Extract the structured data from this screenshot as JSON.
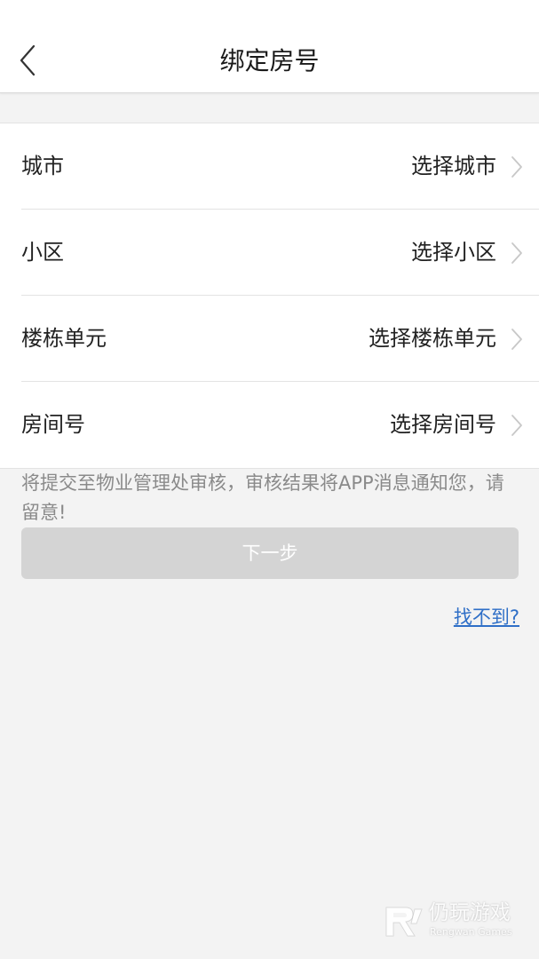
{
  "header": {
    "title": "绑定房号",
    "back_icon": "chevron-left-icon"
  },
  "form": {
    "rows": [
      {
        "label": "城市",
        "value": "选择城市",
        "icon": "chevron-right-icon"
      },
      {
        "label": "小区",
        "value": "选择小区",
        "icon": "chevron-right-icon"
      },
      {
        "label": "楼栋单元",
        "value": "选择楼栋单元",
        "icon": "chevron-right-icon"
      },
      {
        "label": "房间号",
        "value": "选择房间号",
        "icon": "chevron-right-icon"
      }
    ]
  },
  "notice": "将提交至物业管理处审核，审核结果将APP消息通知您，请留意!",
  "actions": {
    "next_label": "下一步",
    "not_found_label": "找不到?"
  },
  "watermark": {
    "name": "仍玩游戏",
    "sub": "Rengwan Games"
  },
  "colors": {
    "background": "#f3f3f3",
    "button_disabled": "#d4d4d4",
    "link": "#2f6fc7",
    "hint_text": "#8a8a8a"
  }
}
